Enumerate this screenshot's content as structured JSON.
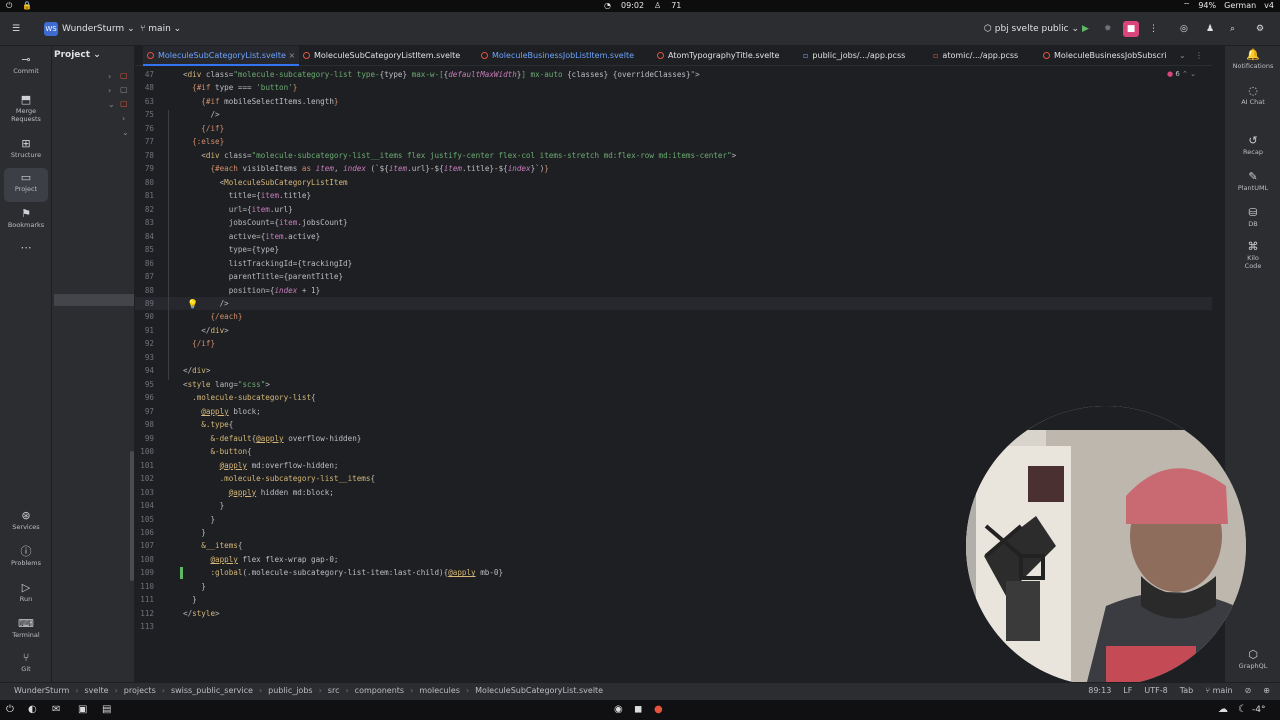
{
  "os_bar": {
    "time": "09:02",
    "notifications": "71",
    "battery": "94%",
    "keyboard": "German",
    "vpn": "v4"
  },
  "titlebar": {
    "project_badge": "WS",
    "project_name": "WunderSturm",
    "branch": "main",
    "run_config": "pbj svelte public"
  },
  "left_strip": {
    "items": [
      {
        "label": "Commit"
      },
      {
        "label": "Merge Requests"
      },
      {
        "label": "Structure"
      },
      {
        "label": "Project"
      },
      {
        "label": "Bookmarks"
      },
      {
        "label": "Services"
      },
      {
        "label": "Problems"
      },
      {
        "label": "Run"
      },
      {
        "label": "Terminal"
      },
      {
        "label": "Git"
      }
    ]
  },
  "project_panel": {
    "title": "Project"
  },
  "tabs": [
    {
      "label": "MoleculeSubCategoryList.svelte",
      "active": true
    },
    {
      "label": "MoleculeSubCategoryListItem.svelte"
    },
    {
      "label": "MoleculeBusinessJobListItem.svelte"
    },
    {
      "label": "AtomTypographyTitle.svelte"
    },
    {
      "label": "public_jobs/.../app.pcss"
    },
    {
      "label": "atomic/.../app.pcss"
    },
    {
      "label": "MoleculeBusinessJobSubscri"
    }
  ],
  "problems_count": "6",
  "code_lines": [
    {
      "n": "47",
      "html": "<span class='p'>&lt;</span><span class='t'>div</span> <span class='a'>class</span>=<span class='s'>\"molecule-subcategory-list type-</span><span class='p'>{type}</span><span class='s'> max-w-[</span><span class='p'>{</span><span class='i'>defaultMaxWidth</span><span class='p'>}</span><span class='s'>] mx-auto </span><span class='p'>{classes} {overrideClasses}</span><span class='s'>\"</span><span class='p'>&gt;</span>"
    },
    {
      "n": "48",
      "html": "  <span class='k'>{#if</span> <span class='p'>type === </span><span class='s'>'button'</span><span class='k'>}</span>"
    },
    {
      "n": "63",
      "html": "    <span class='k'>{#if</span> <span class='p'>mobileSelectItems.length</span><span class='k'>}</span>"
    },
    {
      "n": "75",
      "html": "      <span class='p'>/&gt;</span>"
    },
    {
      "n": "76",
      "html": "    <span class='k'>{/if}</span>"
    },
    {
      "n": "77",
      "html": "  <span class='k'>{:else}</span>"
    },
    {
      "n": "78",
      "html": "    <span class='p'>&lt;</span><span class='t'>div</span> <span class='a'>class</span>=<span class='s'>\"molecule-subcategory-list__items flex justify-center flex-col items-stretch md:flex-row md:items-center\"</span><span class='p'>&gt;</span>"
    },
    {
      "n": "79",
      "html": "      <span class='k'>{#each</span> <span class='p'>visibleItems</span> <span class='k'>as</span> <span class='i'>item</span><span class='p'>, </span><span class='i'>index</span> <span class='p'>(`${</span><span class='i'>item</span><span class='p'>.url}-${</span><span class='i'>item</span><span class='p'>.title}-${</span><span class='i'>index</span><span class='p'>}`)</span><span class='k'>}</span>"
    },
    {
      "n": "80",
      "html": "        <span class='p'>&lt;</span><span class='t'>MoleculeSubCategoryListItem</span>"
    },
    {
      "n": "81",
      "html": "          <span class='a'>title</span>=<span class='p'>{</span><span class='v'>item</span><span class='p'>.title}</span>"
    },
    {
      "n": "82",
      "html": "          <span class='a'>url</span>=<span class='p'>{</span><span class='v'>item</span><span class='p'>.url}</span>"
    },
    {
      "n": "83",
      "html": "          <span class='a'>jobsCount</span>=<span class='p'>{</span><span class='v'>item</span><span class='p'>.jobsCount}</span>"
    },
    {
      "n": "84",
      "html": "          <span class='a'>active</span>=<span class='p'>{</span><span class='v'>item</span><span class='p'>.active}</span>"
    },
    {
      "n": "85",
      "html": "          <span class='a'>type</span>=<span class='p'>{type}</span>"
    },
    {
      "n": "86",
      "html": "          <span class='a'>listTrackingId</span>=<span class='p'>{trackingId}</span>"
    },
    {
      "n": "87",
      "html": "          <span class='a'>parentTitle</span>=<span class='p'>{parentTitle}</span>"
    },
    {
      "n": "88",
      "html": "          <span class='a'>position</span>=<span class='p'>{</span><span class='i'>index</span><span class='p'> + 1}</span>"
    },
    {
      "n": "89",
      "html": "        <span class='p'>/&gt;</span>",
      "current": true
    },
    {
      "n": "90",
      "html": "      <span class='k'>{/each}</span>"
    },
    {
      "n": "91",
      "html": "    <span class='p'>&lt;/</span><span class='t'>div</span><span class='p'>&gt;</span>"
    },
    {
      "n": "92",
      "html": "  <span class='k'>{/if}</span>"
    },
    {
      "n": "93",
      "html": ""
    },
    {
      "n": "94",
      "html": "<span class='p'>&lt;/</span><span class='t'>div</span><span class='p'>&gt;</span>"
    },
    {
      "n": "95",
      "html": "<span class='p'>&lt;</span><span class='t'>style</span> <span class='a'>lang</span>=<span class='s'>\"scss\"</span><span class='p'>&gt;</span>"
    },
    {
      "n": "96",
      "html": "  <span class='t'>.molecule-subcategory-list</span><span class='p'>{</span>"
    },
    {
      "n": "97",
      "html": "    <span class='u'>@apply</span> <span class='p'>block;</span>"
    },
    {
      "n": "98",
      "html": "    <span class='t'>&amp;.type</span><span class='p'>{</span>"
    },
    {
      "n": "99",
      "html": "      <span class='t'>&amp;-default</span><span class='p'>{</span><span class='u'>@apply</span> <span class='p'>overflow-hidden}</span>"
    },
    {
      "n": "100",
      "html": "      <span class='t'>&amp;-button</span><span class='p'>{</span>"
    },
    {
      "n": "101",
      "html": "        <span class='u'>@apply</span> <span class='p'>md:overflow-hidden;</span>"
    },
    {
      "n": "102",
      "html": "        <span class='t'>.molecule-subcategory-list__items</span><span class='p'>{</span>"
    },
    {
      "n": "103",
      "html": "          <span class='u'>@apply</span> <span class='p'>hidden md:block;</span>"
    },
    {
      "n": "104",
      "html": "        <span class='p'>}</span>"
    },
    {
      "n": "105",
      "html": "      <span class='p'>}</span>"
    },
    {
      "n": "106",
      "html": "    <span class='p'>}</span>"
    },
    {
      "n": "107",
      "html": "    <span class='t'>&amp;__items</span><span class='p'>{</span>"
    },
    {
      "n": "108",
      "html": "      <span class='u'>@apply</span> <span class='p'>flex flex-wrap gap-0;</span>"
    },
    {
      "n": "109",
      "html": "      <span class='t'>:global</span><span class='p'>(.molecule-subcategory-list-item:last-child){</span><span class='u'>@apply</span> <span class='p'>mb-0}</span>"
    },
    {
      "n": "110",
      "html": "    <span class='p'>}</span>"
    },
    {
      "n": "111",
      "html": "  <span class='p'>}</span>"
    },
    {
      "n": "112",
      "html": "<span class='p'>&lt;/</span><span class='t'>style</span><span class='p'>&gt;</span>"
    },
    {
      "n": "113",
      "html": ""
    }
  ],
  "right_strip": {
    "items": [
      {
        "label": "Notifications"
      },
      {
        "label": "AI Chat"
      },
      {
        "label": "Recap"
      },
      {
        "label": "PlantUML"
      },
      {
        "label": "DB"
      },
      {
        "label": "Kilo Code"
      },
      {
        "label": "GraphQL"
      }
    ]
  },
  "breadcrumbs": [
    "WunderSturm",
    "svelte",
    "projects",
    "swiss_public_service",
    "public_jobs",
    "src",
    "components",
    "molecules",
    "MoleculeSubCategoryList.svelte"
  ],
  "status": {
    "position": "89:13",
    "line_ending": "LF",
    "encoding": "UTF-8",
    "indent": "Tab",
    "branch": "main"
  },
  "taskbar": {
    "temp": "-4°"
  }
}
